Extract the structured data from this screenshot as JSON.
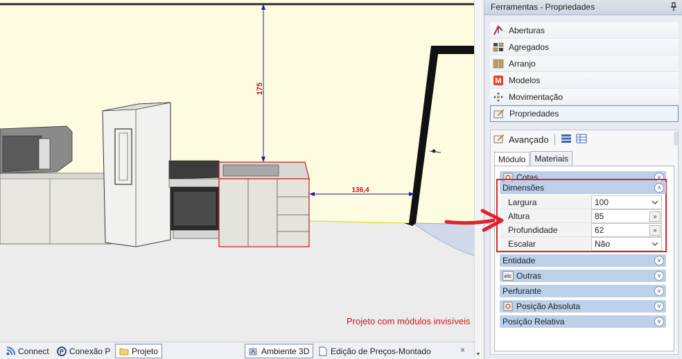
{
  "viewport": {
    "dim_vertical": "175",
    "dim_horizontal": "136,4",
    "note": "Projeto com módulos invisíveis"
  },
  "bottom_tabs": [
    {
      "label": "Connect"
    },
    {
      "label": "Conexão P"
    },
    {
      "label": "Projeto",
      "active": true
    },
    {
      "label": "Ambiente 3D",
      "active": true
    },
    {
      "label": "Edição de Preços-Montado"
    }
  ],
  "tab_close": "×",
  "panel": {
    "title": "Ferramentas - Propriedades",
    "tools": [
      {
        "label": "Aberturas",
        "icon": "openings-icon"
      },
      {
        "label": "Agregados",
        "icon": "aggregates-icon"
      },
      {
        "label": "Arranjo",
        "icon": "arrangement-icon"
      },
      {
        "label": "Modelos",
        "icon": "models-icon"
      },
      {
        "label": "Movimentação",
        "icon": "move-icon"
      },
      {
        "label": "Propriedades",
        "icon": "properties-icon",
        "selected": true
      }
    ],
    "props": {
      "toolbar_label": "Avançado",
      "tabs": [
        "Módulo",
        "Materiais"
      ],
      "groups": {
        "cotas": "Cotas",
        "dimensoes": "Dimensões",
        "entidade": "Entidade",
        "outras": "Outras",
        "outras_icon_text": "etc",
        "perfurante": "Perfurante",
        "posicao_absoluta": "Posição Absoluta",
        "posicao_relativa": "Posição Relativa"
      },
      "dimension_rows": [
        {
          "label": "Largura",
          "value": "100",
          "control": "dropdown"
        },
        {
          "label": "Altura",
          "value": "85",
          "control": "ellipsis"
        },
        {
          "label": "Profundidade",
          "value": "62",
          "control": "ellipsis"
        },
        {
          "label": "Escalar",
          "value": "Não",
          "control": "dropdown"
        }
      ],
      "ellipsis": "»",
      "chevron_down": "˅",
      "chevron_up": "˄"
    }
  },
  "colors": {
    "accent_red": "#e0202a",
    "group_header": "#bcd0ea",
    "dimension_line": "#1a1aa8",
    "dimension_text": "#c8141a"
  }
}
